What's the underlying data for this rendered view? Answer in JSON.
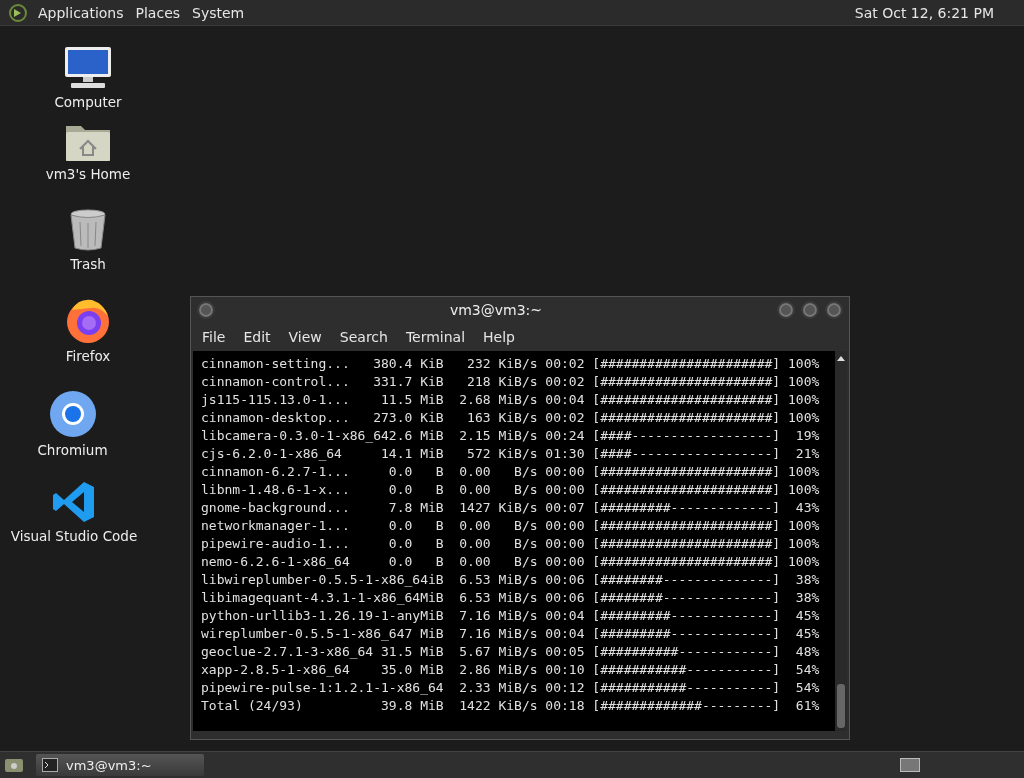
{
  "top_panel": {
    "menus": [
      "Applications",
      "Places",
      "System"
    ],
    "clock": "Sat Oct 12,  6:21 PM"
  },
  "desktop_icons": [
    {
      "label": "Computer",
      "kind": "computer"
    },
    {
      "label": "vm3's Home",
      "kind": "home"
    },
    {
      "label": "Trash",
      "kind": "trash"
    },
    {
      "label": "Firefox",
      "kind": "firefox"
    },
    {
      "label": "Chromium",
      "kind": "chromium"
    },
    {
      "label": "Visual Studio Code",
      "kind": "vscode"
    }
  ],
  "terminal": {
    "title": "vm3@vm3:~",
    "menu": [
      "File",
      "Edit",
      "View",
      "Search",
      "Terminal",
      "Help"
    ],
    "lines": [
      "cinnamon-setting...   380.4 KiB   232 KiB/s 00:02 [######################] 100%",
      "cinnamon-control...   331.7 KiB   218 KiB/s 00:02 [######################] 100%",
      "js115-115.13.0-1...    11.5 MiB  2.68 MiB/s 00:04 [######################] 100%",
      "cinnamon-desktop...   273.0 KiB   163 KiB/s 00:02 [######################] 100%",
      "libcamera-0.3.0-1-x86_642.6 MiB  2.15 MiB/s 00:24 [####------------------]  19%",
      "cjs-6.2.0-1-x86_64     14.1 MiB   572 KiB/s 01:30 [####------------------]  21%",
      "cinnamon-6.2.7-1...     0.0   B  0.00   B/s 00:00 [######################] 100%",
      "libnm-1.48.6-1-x...     0.0   B  0.00   B/s 00:00 [######################] 100%",
      "gnome-background...     7.8 MiB  1427 KiB/s 00:07 [#########-------------]  43%",
      "networkmanager-1...     0.0   B  0.00   B/s 00:00 [######################] 100%",
      "pipewire-audio-1...     0.0   B  0.00   B/s 00:00 [######################] 100%",
      "nemo-6.2.6-1-x86_64     0.0   B  0.00   B/s 00:00 [######################] 100%",
      "libwireplumber-0.5.5-1-x86_64iB  6.53 MiB/s 00:06 [########--------------]  38%",
      "libimagequant-4.3.1-1-x86_64MiB  6.53 MiB/s 00:06 [########--------------]  38%",
      "python-urllib3-1.26.19-1-anyMiB  7.16 MiB/s 00:04 [#########-------------]  45%",
      "wireplumber-0.5.5-1-x86_647 MiB  7.16 MiB/s 00:04 [#########-------------]  45%",
      "geoclue-2.7.1-3-x86_64 31.5 MiB  5.67 MiB/s 00:05 [##########------------]  48%",
      "xapp-2.8.5-1-x86_64    35.0 MiB  2.86 MiB/s 00:10 [###########-----------]  54%",
      "pipewire-pulse-1:1.2.1-1-x86_64  2.33 MiB/s 00:12 [###########-----------]  54%",
      "Total (24/93)          39.8 MiB  1422 KiB/s 00:18 [#############---------]  61%"
    ]
  },
  "taskbar": {
    "items": [
      {
        "label": "vm3@vm3:~"
      }
    ]
  }
}
